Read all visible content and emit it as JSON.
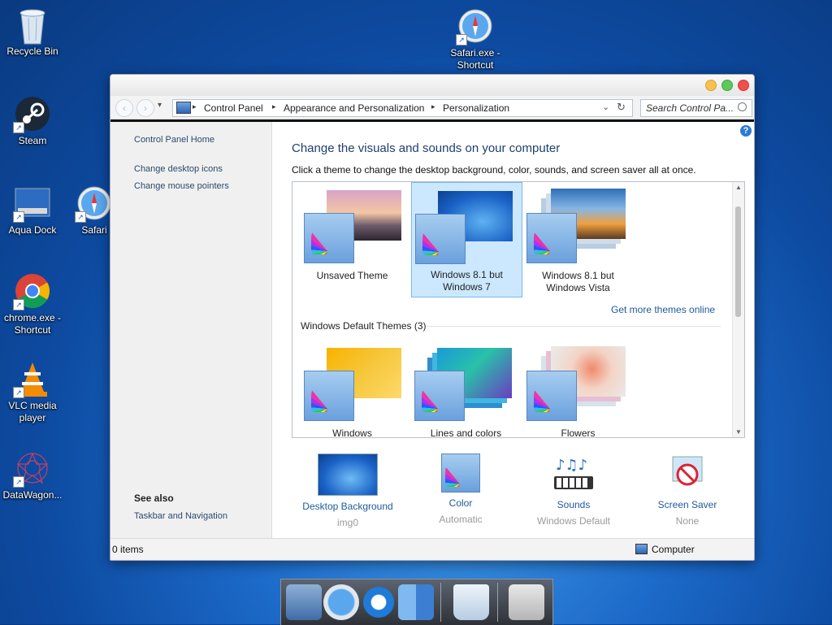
{
  "desktop": {
    "icons": [
      {
        "label": "Recycle Bin"
      },
      {
        "label": "Safari.exe - Shortcut"
      },
      {
        "label": "Steam"
      },
      {
        "label": "Aqua Dock"
      },
      {
        "label": "Safari"
      },
      {
        "label": "chrome.exe - Shortcut"
      },
      {
        "label": "VLC media player"
      },
      {
        "label": "DataWagon..."
      }
    ]
  },
  "window": {
    "address": {
      "crumbs": [
        "Control Panel",
        "Appearance and Personalization",
        "Personalization"
      ],
      "search_placeholder": "Search Control Pa..."
    },
    "left_pane": {
      "home": "Control Panel Home",
      "links": [
        "Change desktop icons",
        "Change mouse pointers"
      ],
      "see_also_title": "See also",
      "see_also_links": [
        "Taskbar and Navigation"
      ]
    },
    "main": {
      "heading": "Change the visuals and sounds on your computer",
      "subheading": "Click a theme to change the desktop background, color, sounds, and screen saver all at once.",
      "my_themes": [
        {
          "label": "Unsaved Theme"
        },
        {
          "label": "Windows 8.1 but Windows 7",
          "selected": true
        },
        {
          "label": "Windows 8.1 but Windows Vista"
        }
      ],
      "get_more": "Get more themes online",
      "default_group": "Windows Default Themes (3)",
      "default_themes": [
        {
          "label": "Windows"
        },
        {
          "label": "Lines and colors"
        },
        {
          "label": "Flowers"
        }
      ],
      "bottom": [
        {
          "title": "Desktop Background",
          "value": "img0"
        },
        {
          "title": "Color",
          "value": "Automatic"
        },
        {
          "title": "Sounds",
          "value": "Windows Default"
        },
        {
          "title": "Screen Saver",
          "value": "None"
        }
      ]
    },
    "status": {
      "items": "0 items",
      "location": "Computer"
    }
  },
  "dock": {
    "items": [
      "Mail",
      "Safari",
      "Internet Explorer",
      "Finder",
      "Recycle Bin",
      "Apple Menu"
    ]
  },
  "colors": {
    "link": "#1e5a9c",
    "heading": "#1e3f6e",
    "selection": "#cce8ff"
  }
}
